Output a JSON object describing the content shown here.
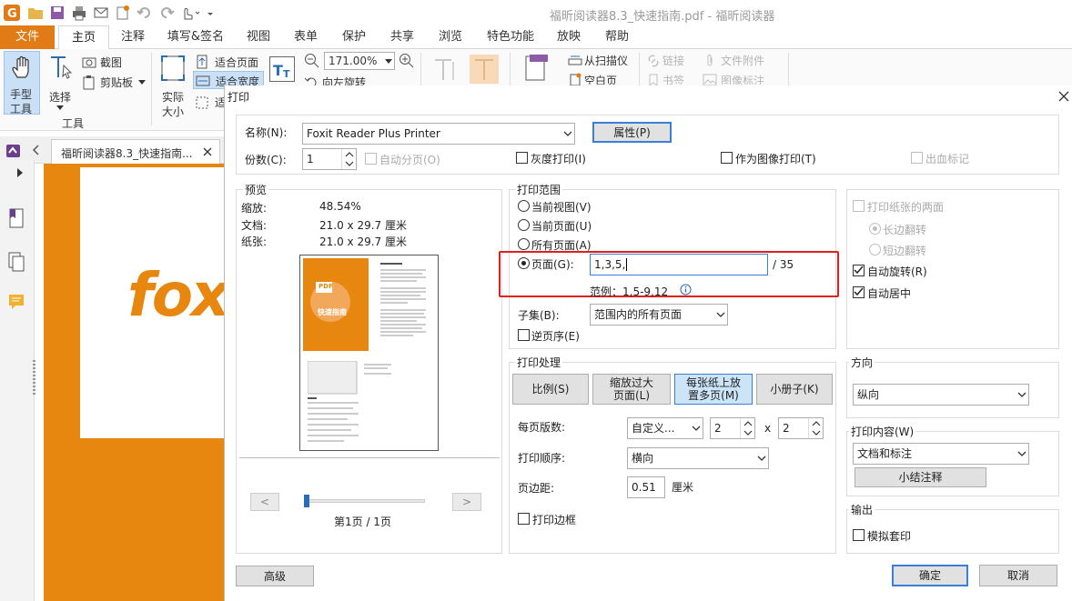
{
  "app": {
    "title": "福昕阅读器8.3_快速指南.pdf - 福昕阅读器"
  },
  "menu": {
    "tabs": [
      "文件",
      "主页",
      "注释",
      "填写&签名",
      "视图",
      "表单",
      "保护",
      "共享",
      "浏览",
      "特色功能",
      "放映",
      "帮助"
    ],
    "active": "主页"
  },
  "ribbon": {
    "hand_tool": [
      "手型",
      "工具"
    ],
    "select": "选择",
    "screenshot": "截图",
    "clipboard": "剪贴板",
    "tools_group": "工具",
    "actual_size": [
      "实际",
      "大小"
    ],
    "fit_page": "适合页面",
    "fit_width": "适合宽度",
    "fit_visible": "适",
    "zoom_value": "171.00%",
    "rotate_left": "向左旋转",
    "from_scanner": "从扫描仪",
    "blank_page": "空白页",
    "link": "链接",
    "bookmark": "书签",
    "file_attachment": "文件附件",
    "image_annotation": "图像标注"
  },
  "doc_tab": {
    "label": "福昕阅读器8.3_快速指南..."
  },
  "doc_page": {
    "logo_text": "fox"
  },
  "dialog": {
    "title": "打印",
    "name_label": "名称(N):",
    "printer": "Foxit Reader Plus Printer",
    "properties_btn": "属性(P)",
    "copies_label": "份数(C):",
    "copies_value": "1",
    "collate": "自动分页(O)",
    "grayscale": "灰度打印(I)",
    "print_as_image": "作为图像打印(T)",
    "bleed_marks": "出血标记",
    "preview": {
      "title": "预览",
      "zoom_label": "缩放:",
      "zoom_value": "48.54%",
      "doc_label": "文档:",
      "doc_value": "21.0 x 29.7 厘米",
      "paper_label": "纸张:",
      "paper_value": "21.0 x 29.7 厘米",
      "thumb_title": "快速指南",
      "thumb_pdf": "PDF",
      "page_indicator": "第1页 / 1页",
      "prev": "<",
      "next": ">"
    },
    "range": {
      "title": "打印范围",
      "current_view": "当前视图(V)",
      "current_page": "当前页面(U)",
      "all_pages": "所有页面(A)",
      "pages": "页面(G):",
      "pages_value": "1,3,5,",
      "total": "/ 35",
      "example": "范例：1,5-9,12",
      "subset_label": "子集(B):",
      "subset_value": "范围内的所有页面",
      "reverse": "逆页序(E)"
    },
    "duplex": {
      "both_sides": "打印纸张的两面",
      "long_edge": "长边翻转",
      "short_edge": "短边翻转",
      "auto_rotate": "自动旋转(R)",
      "auto_center": "自动居中"
    },
    "handling": {
      "title": "打印处理",
      "scale_btn": "比例(S)",
      "fit_btn": [
        "缩放过大",
        "页面(L)"
      ],
      "multi_btn": [
        "每张纸上放",
        "置多页(M)"
      ],
      "booklet_btn": "小册子(K)",
      "pages_per_sheet_label": "每页版数:",
      "pages_per_sheet_value": "自定义...",
      "cols": "2",
      "times": "x",
      "rows": "2",
      "order_label": "打印顺序:",
      "order_value": "横向",
      "margin_label": "页边距:",
      "margin_value": "0.51",
      "margin_unit": "厘米",
      "print_border": "打印边框"
    },
    "orientation": {
      "title": "方向",
      "value": "纵向"
    },
    "content": {
      "title": "打印内容(W)",
      "value": "文档和标注",
      "summarize_btn": "小结注释"
    },
    "output": {
      "title": "输出",
      "simulate_overprint": "模拟套印"
    },
    "advanced_btn": "高级",
    "ok_btn": "确定",
    "cancel_btn": "取消"
  },
  "colors": {
    "accent_orange": "#e07b16",
    "highlight_red": "#e02020",
    "focus_blue": "#3a7fd5"
  }
}
